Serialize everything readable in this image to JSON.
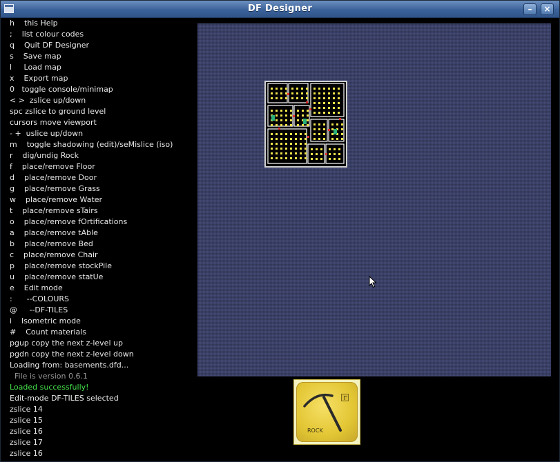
{
  "window": {
    "title": "DF Designer"
  },
  "help_lines": [
    {
      "text": "h    this Help",
      "style": "normal"
    },
    {
      "text": ";    list colour codes",
      "style": "normal"
    },
    {
      "text": "q    Quit DF Designer",
      "style": "normal"
    },
    {
      "text": "s    Save map",
      "style": "normal"
    },
    {
      "text": "l     Load map",
      "style": "normal"
    },
    {
      "text": "x    Export map",
      "style": "normal"
    },
    {
      "text": "0   toggle console/minimap",
      "style": "normal"
    },
    {
      "text": "< >  zslice up/down",
      "style": "normal"
    },
    {
      "text": "spc zslice to ground level",
      "style": "normal"
    },
    {
      "text": "cursors move viewport",
      "style": "normal"
    },
    {
      "text": "- +  uslice up/down",
      "style": "normal"
    },
    {
      "text": "m    toggle shadowing (edit)/seMislice (iso)",
      "style": "normal"
    },
    {
      "text": "r    dig/undig Rock",
      "style": "normal"
    },
    {
      "text": "f    place/remove Floor",
      "style": "normal"
    },
    {
      "text": "d    place/remove Door",
      "style": "normal"
    },
    {
      "text": "g    place/remove Grass",
      "style": "normal"
    },
    {
      "text": "w    place/remove Water",
      "style": "normal"
    },
    {
      "text": "t    place/remove sTairs",
      "style": "normal"
    },
    {
      "text": "o    place/remove fOrtifications",
      "style": "normal"
    },
    {
      "text": "a    place/remove tAble",
      "style": "normal"
    },
    {
      "text": "b    place/remove Bed",
      "style": "normal"
    },
    {
      "text": "c    place/remove Chair",
      "style": "normal"
    },
    {
      "text": "p    place/remove stockPile",
      "style": "normal"
    },
    {
      "text": "u    place/remove statUe",
      "style": "normal"
    },
    {
      "text": "e    Edit mode",
      "style": "normal"
    },
    {
      "text": ":      --COLOURS",
      "style": "normal"
    },
    {
      "text": "@     --DF-TILES",
      "style": "normal"
    },
    {
      "text": "i    Isometric mode",
      "style": "normal"
    },
    {
      "text": "#    Count materials",
      "style": "normal"
    },
    {
      "text": "pgup copy the next z-level up",
      "style": "normal"
    },
    {
      "text": "pgdn copy the next z-level down",
      "style": "normal"
    },
    {
      "text": "Loading from: basements.dfd...",
      "style": "normal"
    },
    {
      "text": "  File is version 0.6.1",
      "style": "grey"
    },
    {
      "text": "Loaded successfully!",
      "style": "green"
    },
    {
      "text": "Edit-mode DF-TILES selected",
      "style": "normal"
    },
    {
      "text": "zslice 14",
      "style": "normal"
    },
    {
      "text": "zslice 15",
      "style": "normal"
    },
    {
      "text": "zslice 16",
      "style": "normal"
    },
    {
      "text": "zslice 17",
      "style": "normal"
    },
    {
      "text": "zslice 16",
      "style": "normal"
    }
  ],
  "tool": {
    "label": "ROCK",
    "icon": "pickaxe-icon"
  },
  "colors": {
    "canvas_bg": "#3a416b",
    "console_text": "#e8e8e8",
    "success_text": "#44e24a",
    "version_text": "#9a9a9a",
    "map_wall": "#ffffff",
    "map_furniture": "#f0e44a",
    "map_door": "#e03030",
    "map_stairs": "#2bb07a"
  }
}
